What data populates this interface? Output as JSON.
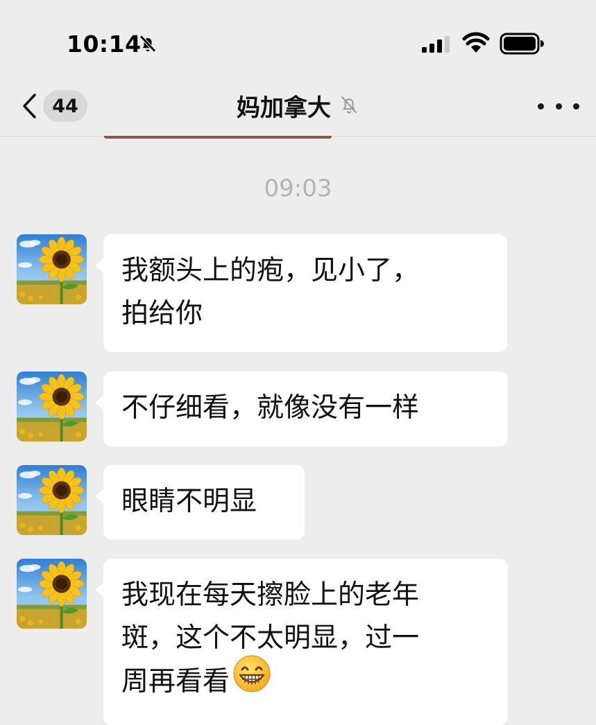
{
  "status_bar": {
    "time": "10:14"
  },
  "nav": {
    "unread_count": "44",
    "title": "妈加拿大",
    "icons": {
      "back": "chevron-left-icon",
      "mute": "bell-off-icon",
      "more": "more-horizontal-icon"
    }
  },
  "messages": {
    "timestamp": "09:03",
    "items": [
      {
        "lines": [
          "我额头上的疱，见小了，",
          "拍给你"
        ]
      },
      {
        "lines": [
          "不仔细看，就像没有一样"
        ]
      },
      {
        "lines": [
          "眼睛不明显"
        ]
      },
      {
        "lines": [
          "我现在每天擦脸上的老年",
          "斑，这个不太明显，过一",
          "周再看看"
        ],
        "trailing_emoji": "grinning-face-emoji"
      }
    ]
  },
  "colors": {
    "background": "#ededed",
    "bubble": "#ffffff",
    "timestamp": "#b2b2b2",
    "badge": "#d8d8d8"
  }
}
